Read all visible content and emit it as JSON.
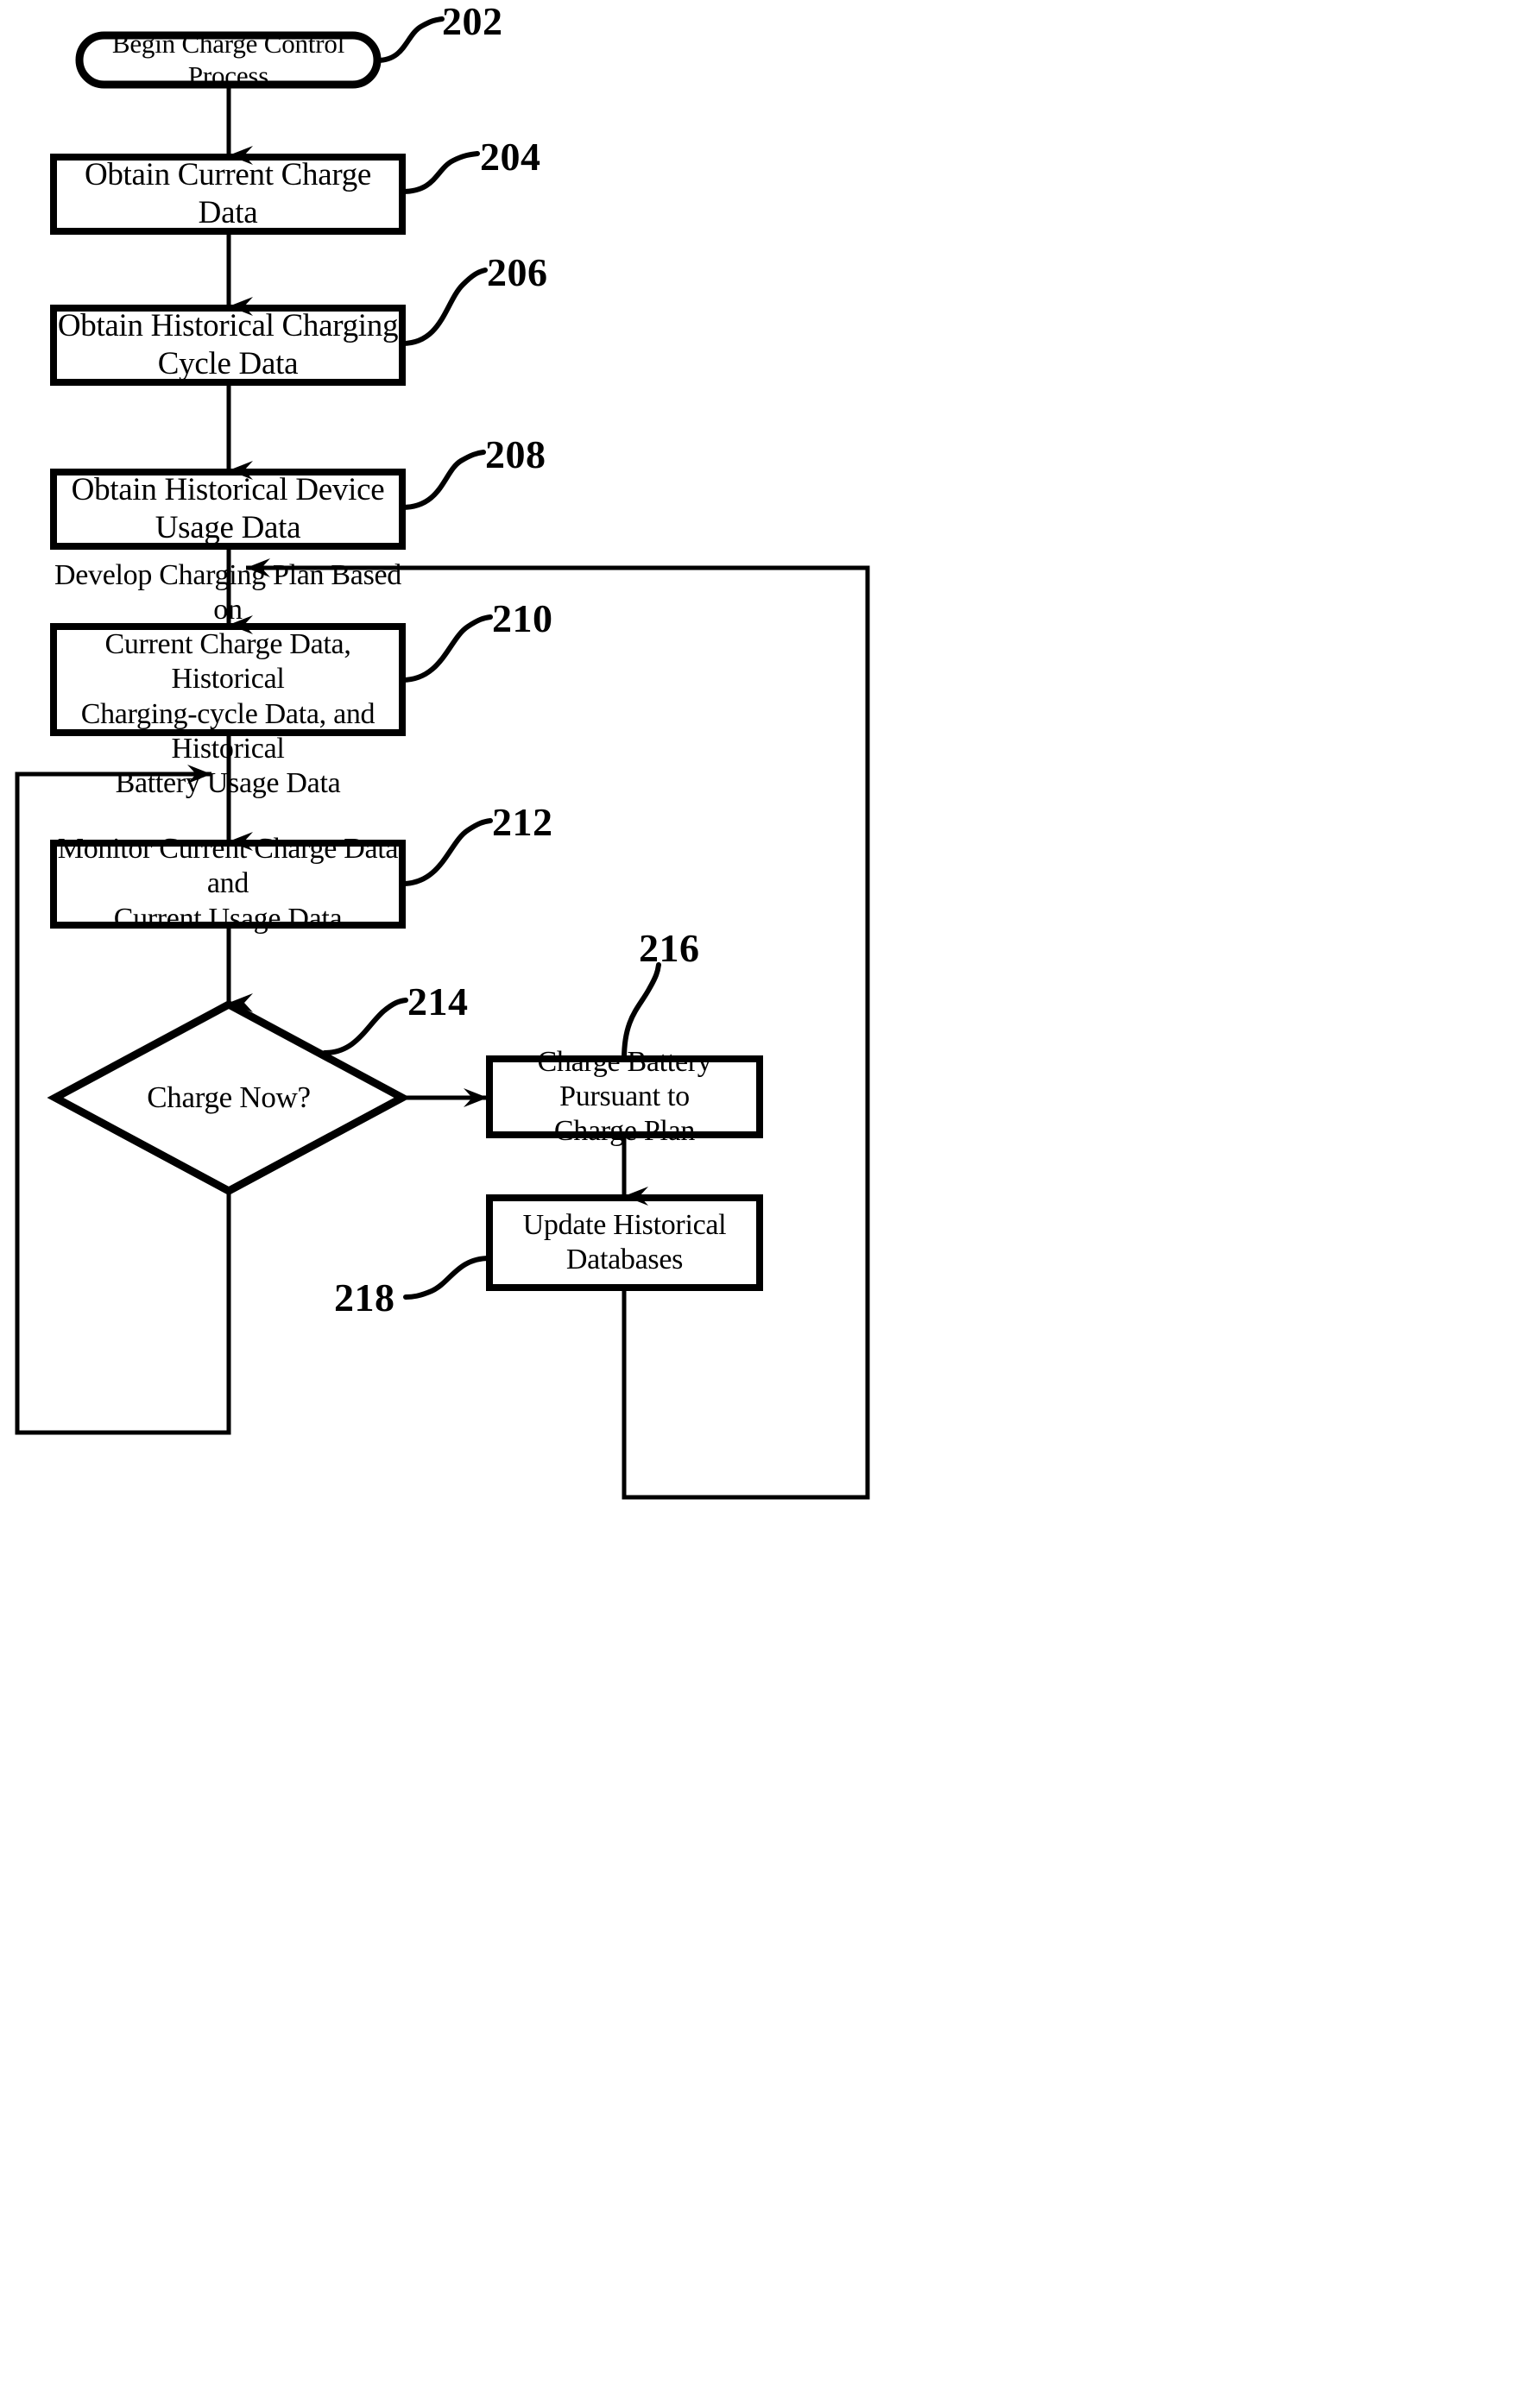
{
  "figure": {
    "kind": "patent-flowchart",
    "background_color": "#ffffff",
    "line_color": "#000000",
    "nodes": [
      {
        "ref": "202",
        "shape": "terminal",
        "text": "Begin Charge Control Process"
      },
      {
        "ref": "204",
        "shape": "process",
        "text": "Obtain Current Charge Data"
      },
      {
        "ref": "206",
        "shape": "process",
        "text": "Obtain Historical Charging Cycle Data"
      },
      {
        "ref": "208",
        "shape": "process",
        "text": "Obtain Historical Device Usage Data"
      },
      {
        "ref": "210",
        "shape": "process",
        "text": "Develop Charging Plan Based on\nCurrent Charge Data, Historical\nCharging-cycle Data, and Historical\nBattery Usage Data"
      },
      {
        "ref": "212",
        "shape": "process",
        "text": "Monitor Current Charge Data and\nCurrent Usage Data"
      },
      {
        "ref": "214",
        "shape": "decision",
        "text": "Charge Now?"
      },
      {
        "ref": "216",
        "shape": "process",
        "text": "Charge Battery Pursuant to\nCharge Plan"
      },
      {
        "ref": "218",
        "shape": "process",
        "text": "Update Historical Databases"
      }
    ],
    "reference_numerals": [
      "202",
      "204",
      "206",
      "208",
      "210",
      "212",
      "214",
      "216",
      "218"
    ],
    "edges": [
      {
        "from": "202",
        "to": "204",
        "style": "arrow-down"
      },
      {
        "from": "204",
        "to": "206",
        "style": "arrow-down"
      },
      {
        "from": "206",
        "to": "208",
        "style": "arrow-down"
      },
      {
        "from": "208",
        "to": "210",
        "style": "arrow-down"
      },
      {
        "from": "210",
        "to": "212",
        "style": "arrow-down"
      },
      {
        "from": "212",
        "to": "214",
        "style": "arrow-down"
      },
      {
        "from": "214",
        "to": "216",
        "style": "arrow-right"
      },
      {
        "from": "216",
        "to": "218",
        "style": "arrow-down"
      },
      {
        "from": "218",
        "to": "210",
        "style": "feedback-loop-right"
      },
      {
        "from": "214",
        "to": "212",
        "style": "feedback-loop-left"
      }
    ]
  }
}
